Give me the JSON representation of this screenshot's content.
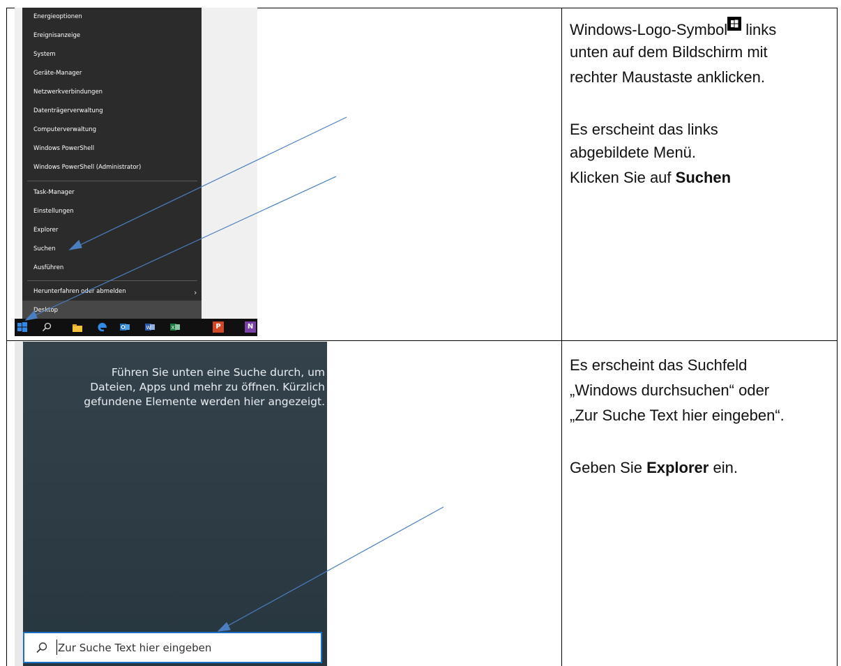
{
  "context_menu": {
    "items": [
      {
        "label": "Energieoptionen"
      },
      {
        "label": "Ereignisanzeige"
      },
      {
        "label": "System"
      },
      {
        "label": "Geräte-Manager"
      },
      {
        "label": "Netzwerkverbindungen"
      },
      {
        "label": "Datenträgerverwaltung"
      },
      {
        "label": "Computerverwaltung"
      },
      {
        "label": "Windows PowerShell"
      },
      {
        "label": "Windows PowerShell (Administrator)"
      },
      {
        "label": "Task-Manager"
      },
      {
        "label": "Einstellungen"
      },
      {
        "label": "Explorer"
      },
      {
        "label": "Suchen"
      },
      {
        "label": "Ausführen"
      },
      {
        "label": "Herunterfahren oder abmelden"
      },
      {
        "label": "Desktop"
      }
    ]
  },
  "taskbar": {
    "icons": [
      "windows-start-icon",
      "search-icon",
      "file-explorer-icon",
      "edge-icon",
      "outlook-icon",
      "word-icon",
      "excel-icon",
      "powerpoint-icon",
      "onenote-icon"
    ],
    "icon_labels": {
      "powerpoint": "P",
      "onenote": "N"
    }
  },
  "instructions": {
    "step1": {
      "line1": "Windows-Logo-Symbol",
      "line1_tail": "links",
      "line2": "unten auf dem Bildschirm mit",
      "line3": "rechter Maustaste  anklicken.",
      "line4": "Es erscheint das links",
      "line5": "abgebildete Menü.",
      "line6_prefix": "Klicken Sie auf ",
      "line6_bold": "Suchen"
    },
    "step2": {
      "line1": "Es erscheint das Suchfeld",
      "line2": "„Windows durchsuchen“ oder",
      "line3": "„Zur Suche Text hier eingeben“.",
      "line4_prefix": "Geben Sie ",
      "line4_bold": "Explorer",
      "line4_suffix": " ein."
    }
  },
  "search_pane": {
    "hint_line1": "Führen Sie unten eine Suche durch, um",
    "hint_line2": "Dateien, Apps und mehr zu öffnen. Kürzlich",
    "hint_line3": "gefundene Elemente werden hier angezeigt.",
    "placeholder": "Zur Suche Text hier eingeben"
  },
  "colors": {
    "menu_bg": "#2b2b2b",
    "arrow": "#4a7ebf",
    "search_border": "#1c6fc7",
    "pane_bg": "#2f3d47"
  }
}
